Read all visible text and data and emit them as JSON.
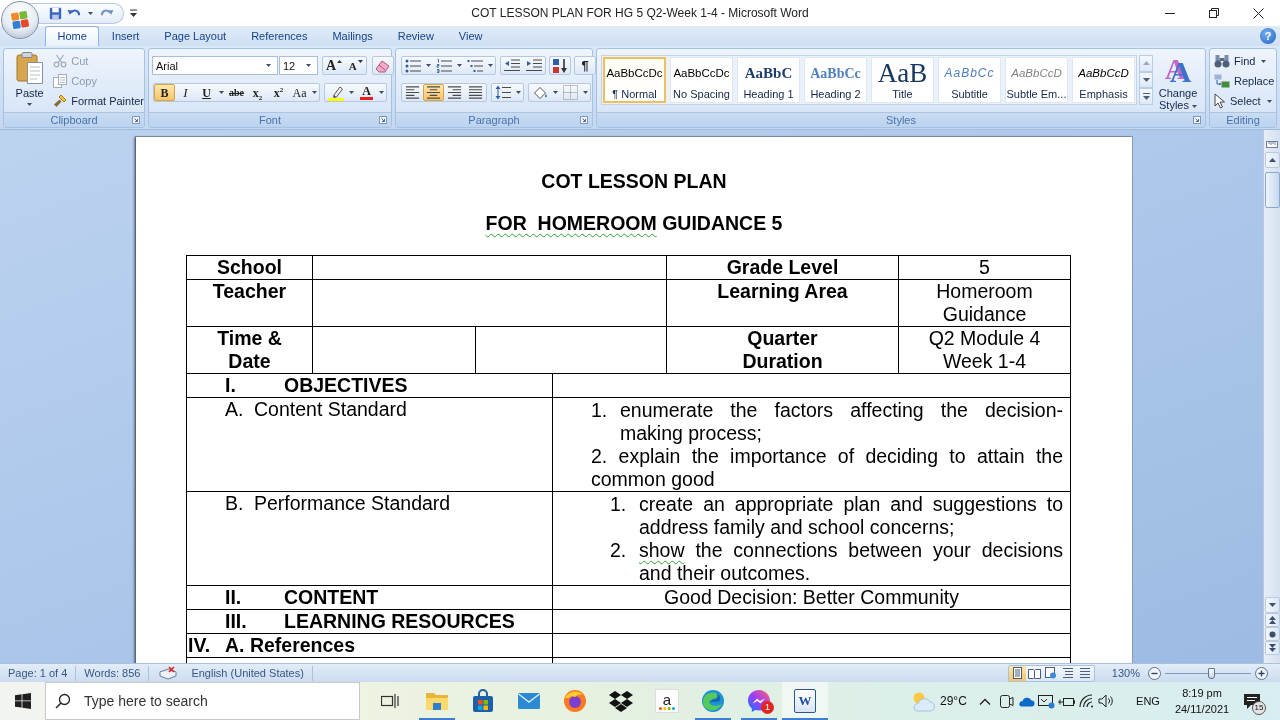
{
  "window": {
    "title": "COT LESSON PLAN FOR HG 5 Q2-Week 1-4 - Microsoft Word"
  },
  "ribbon": {
    "tabs": [
      {
        "label": "Home",
        "selected": true
      },
      {
        "label": "Insert",
        "selected": false
      },
      {
        "label": "Page Layout",
        "selected": false
      },
      {
        "label": "References",
        "selected": false
      },
      {
        "label": "Mailings",
        "selected": false
      },
      {
        "label": "Review",
        "selected": false
      },
      {
        "label": "View",
        "selected": false
      }
    ],
    "help": "?",
    "clipboard": {
      "title": "Clipboard",
      "paste": "Paste",
      "commands": [
        {
          "kind": "cut",
          "label": "Cut",
          "disabled": true
        },
        {
          "kind": "copy",
          "label": "Copy",
          "disabled": true
        },
        {
          "kind": "format_painter",
          "label": "Format Painter",
          "disabled": false
        }
      ]
    },
    "font": {
      "title": "Font",
      "font_name": "Arial",
      "font_size": "12",
      "size_buttons": [
        {
          "kind": "grow",
          "label": "A"
        },
        {
          "kind": "shrink",
          "label": "A"
        }
      ],
      "format_buttons": [
        {
          "kind": "bold",
          "label": "B",
          "selected": true
        },
        {
          "kind": "italic",
          "label": "I",
          "selected": false
        },
        {
          "kind": "underline",
          "label": "U",
          "selected": false
        },
        {
          "kind": "strikethrough",
          "label": "abe",
          "selected": false
        },
        {
          "kind": "subscript",
          "label": "x$_{2}$",
          "selected": false
        },
        {
          "kind": "superscript",
          "label": "x$^{2}$",
          "selected": false
        },
        {
          "kind": "change_case",
          "label": "Aa",
          "selected": false
        }
      ],
      "font_color": {
        "label": "A"
      }
    },
    "paragraph": {
      "title": "Paragraph",
      "alignment": [
        {
          "kind": "left",
          "selected": false
        },
        {
          "kind": "center",
          "selected": true
        },
        {
          "kind": "right",
          "selected": false
        },
        {
          "kind": "justify",
          "selected": false
        }
      ],
      "show_marks": {
        "label": "¶",
        "selected": false
      }
    },
    "styles": {
      "title": "Styles",
      "gallery": [
        {
          "kind": "normal",
          "preview": "AaBbCcDc",
          "label": "¶ Normal",
          "selected": true
        },
        {
          "kind": "no_spacing",
          "preview": "AaBbCcDc",
          "label": "No Spacing",
          "selected": false
        },
        {
          "kind": "heading_1",
          "preview": "AaBbC",
          "label": "Heading 1",
          "selected": false
        },
        {
          "kind": "heading_2",
          "preview": "AaBbCc",
          "label": "Heading 2",
          "selected": false
        },
        {
          "kind": "title",
          "preview": "AaB",
          "label": "Title",
          "selected": false
        },
        {
          "kind": "subtitle",
          "preview": "AaBbCc",
          "label": "Subtitle",
          "selected": false
        },
        {
          "kind": "subtle_emphasis",
          "preview": "AaBbCcD",
          "label": "Subtle Em...",
          "selected": false
        },
        {
          "kind": "emphasis",
          "preview": "AaBbCcD",
          "label": "Emphasis",
          "selected": false
        }
      ],
      "change_styles": {
        "glyph": "A",
        "label": "Change Styles"
      }
    },
    "editing": {
      "title": "Editing",
      "commands": [
        {
          "kind": "find",
          "label": "Find",
          "dropdown": true
        },
        {
          "kind": "replace",
          "label": "Replace",
          "dropdown": false
        },
        {
          "kind": "select",
          "label": "Select",
          "dropdown": true
        }
      ]
    }
  },
  "document": {
    "title": "COT LESSON PLAN",
    "subtitle": [
      {
        "text": "FOR  HOMEROOM",
        "grammar_error": true
      },
      {
        "text": " GUIDANCE 5",
        "grammar_error": false
      }
    ],
    "info_rows": [
      {
        "kind": "single",
        "label": "School",
        "right_label": "Grade Level",
        "right_value": "5"
      },
      {
        "kind": "single",
        "label": "Teacher",
        "right_label": "Learning Area",
        "right_value": "Homeroom\nGuidance"
      },
      {
        "kind": "split",
        "label": "Time &\nDate",
        "right_label": "Quarter\nDuration",
        "right_value": "Q2 Module 4\nWeek 1-4"
      }
    ],
    "sections": [
      {
        "kind": "heading",
        "number": "I.",
        "label": "OBJECTIVES"
      },
      {
        "kind": "standard",
        "number": "A.",
        "label": "Content Standard",
        "items": [
          {
            "kind": "numbered",
            "number": "1.",
            "segments": [
              {
                "text": "enumerate the factors affecting the decision-making process;",
                "grammar_error": false
              }
            ]
          },
          {
            "kind": "paragraph",
            "segments": [
              {
                "text": "2. explain the importance of deciding to attain the common good",
                "grammar_error": false
              }
            ]
          }
        ]
      },
      {
        "kind": "standard",
        "number": "B.",
        "label": "Performance Standard",
        "items": [
          {
            "kind": "indented",
            "number": "1.",
            "segments": [
              {
                "text": "create an appropriate plan and suggestions to address family and school concerns;",
                "grammar_error": false
              }
            ]
          },
          {
            "kind": "indented",
            "number": "2.",
            "segments": [
              {
                "text": "show",
                "grammar_error": true
              },
              {
                "text": " the connections between your decisions and their outcomes.",
                "grammar_error": false
              }
            ]
          }
        ]
      },
      {
        "kind": "heading",
        "number": "II.",
        "label": "CONTENT",
        "value": "Good Decision: Better Community"
      },
      {
        "kind": "heading",
        "number": "III.",
        "label": "LEARNING RESOURCES"
      },
      {
        "kind": "subheading",
        "number": "IV.",
        "label": "A. References"
      }
    ]
  },
  "status_bar": {
    "page": "Page: 1 of 4",
    "words": "Words: 856",
    "language": "English (United States)",
    "views": [
      {
        "kind": "print_layout",
        "selected": true
      },
      {
        "kind": "full_screen_reading",
        "selected": false
      },
      {
        "kind": "web_layout",
        "selected": false
      },
      {
        "kind": "outline",
        "selected": false
      },
      {
        "kind": "draft",
        "selected": false
      }
    ],
    "zoom": "130%",
    "zoom_slider": {
      "level": 0.54
    }
  },
  "taskbar": {
    "search": {
      "placeholder": "Type here to search"
    },
    "apps": [
      {
        "kind": "file_explorer",
        "running": true,
        "active": false
      },
      {
        "kind": "store",
        "running": false,
        "active": false
      },
      {
        "kind": "mail",
        "running": false,
        "active": false
      },
      {
        "kind": "firefox",
        "running": false,
        "active": false
      },
      {
        "kind": "dropbox",
        "running": false,
        "active": false
      },
      {
        "kind": "amazon",
        "glyph": "a",
        "running": false,
        "active": false
      },
      {
        "kind": "edge",
        "running": true,
        "active": false
      },
      {
        "kind": "messenger",
        "badge": "1",
        "running": true,
        "active": false
      },
      {
        "kind": "word",
        "glyph": "W",
        "running": true,
        "active": true
      }
    ],
    "weather": "29°C",
    "language": "ENG",
    "time": "8:19 pm",
    "date": "24/11/2021",
    "notifications": "15"
  }
}
